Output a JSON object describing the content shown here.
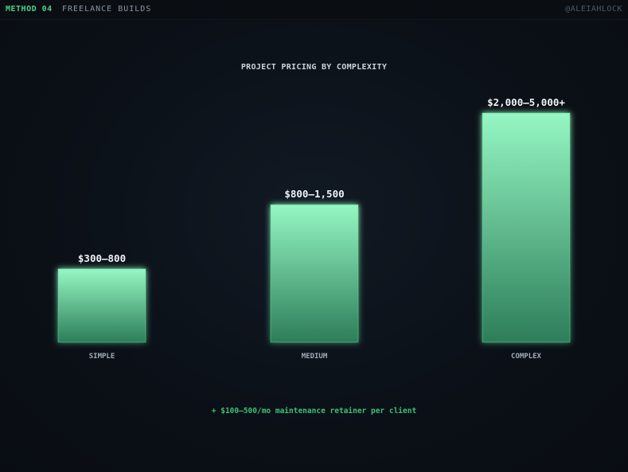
{
  "header": {
    "method_label": "METHOD 04",
    "section_label": "FREELANCE BUILDS",
    "handle": "@ALEIAHLOCK"
  },
  "colors": {
    "accent": "#4ccf86",
    "bar_top": "#95f7c3",
    "bar_bottom": "#2d7d59",
    "background": "#0b1017"
  },
  "chart_data": {
    "type": "bar",
    "title": "PROJECT PRICING BY COMPLEXITY",
    "xlabel": "",
    "ylabel": "",
    "categories": [
      "SIMPLE",
      "MEDIUM",
      "COMPLEX"
    ],
    "value_labels": [
      "$300–800",
      "$800–1,500",
      "$2,000–5,000+"
    ],
    "values": [
      800,
      1500,
      2500
    ],
    "ylim": [
      0,
      2500
    ],
    "grid": false,
    "legend": "none"
  },
  "footnote": "+ $100–500/mo maintenance retainer per client"
}
